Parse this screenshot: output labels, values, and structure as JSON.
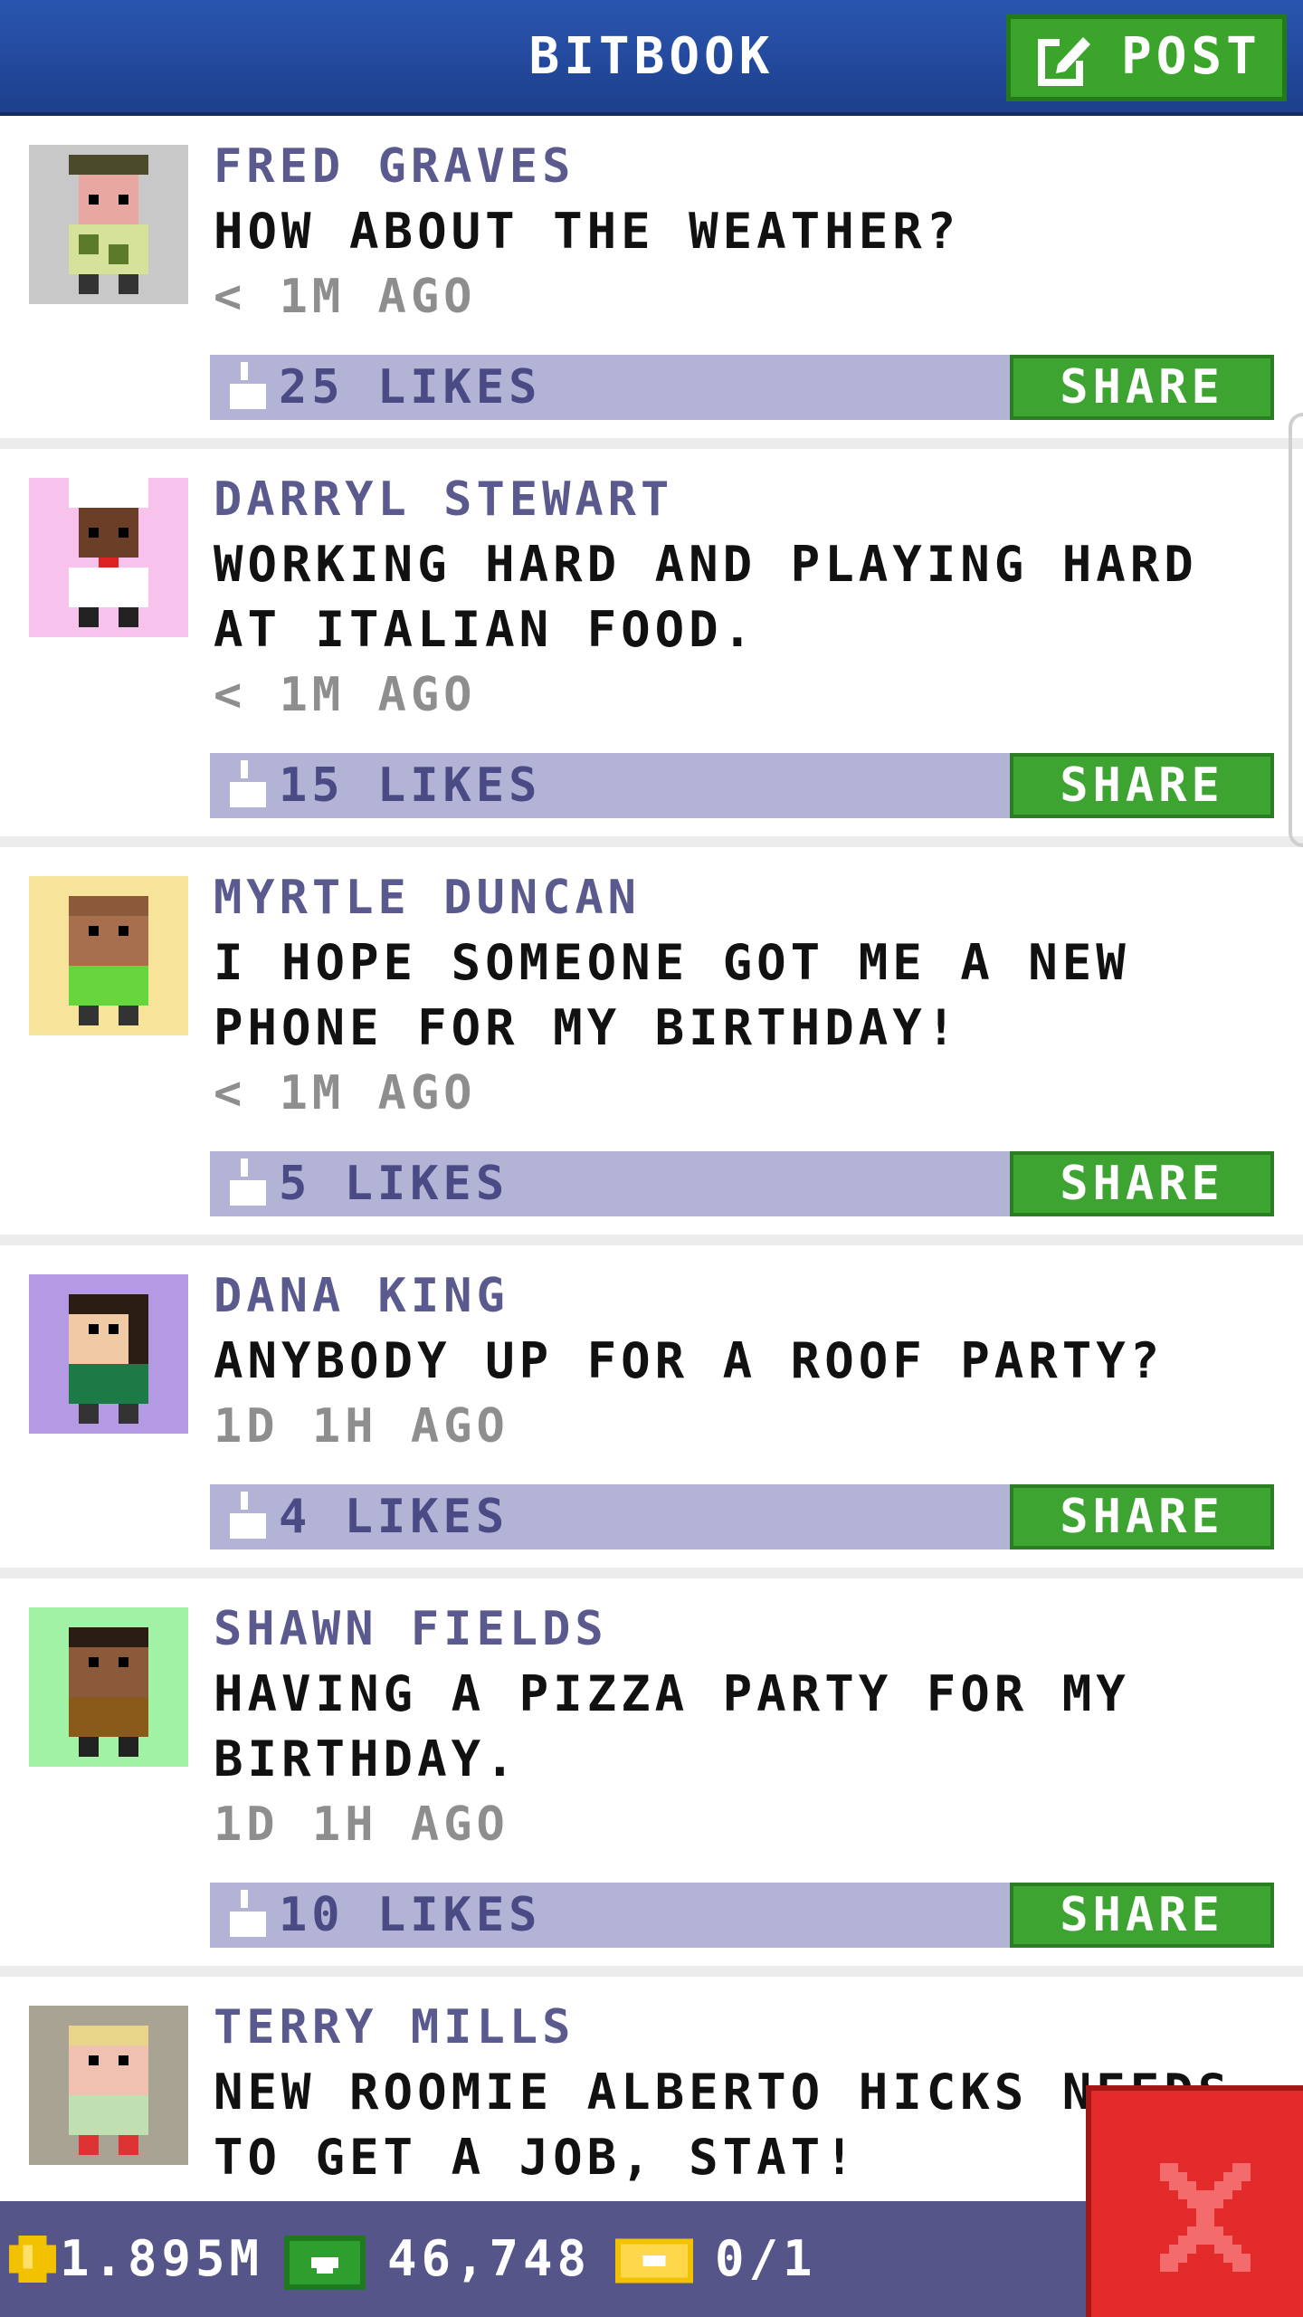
{
  "header": {
    "title": "BITBOOK",
    "post_label": "POST"
  },
  "posts": [
    {
      "author": "FRED GRAVES",
      "message": "HOW ABOUT THE WEATHER?",
      "time": "< 1M AGO",
      "likes": "25 LIKES",
      "share": "SHARE",
      "avatar_bg": "#c8c8c8",
      "avatar_icon": "man-with-flat-cap-avatar"
    },
    {
      "author": "DARRYL STEWART",
      "message": "WORKING HARD AND PLAYING HARD AT ITALIAN FOOD.",
      "time": "< 1M AGO",
      "likes": "15 LIKES",
      "share": "SHARE",
      "avatar_bg": "#f7c3ec",
      "avatar_icon": "chef-avatar"
    },
    {
      "author": "MYRTLE DUNCAN",
      "message": "I HOPE SOMEONE GOT ME A NEW PHONE FOR MY BIRTHDAY!",
      "time": "< 1M AGO",
      "likes": "5 LIKES",
      "share": "SHARE",
      "avatar_bg": "#f7e49a",
      "avatar_icon": "woman-green-shirt-avatar"
    },
    {
      "author": "DANA KING",
      "message": "ANYBODY UP FOR A ROOF PARTY?",
      "time": "1D 1H AGO",
      "likes": "4 LIKES",
      "share": "SHARE",
      "avatar_bg": "#b39ae2",
      "avatar_icon": "woman-dark-hair-avatar"
    },
    {
      "author": "SHAWN FIELDS",
      "message": "HAVING A PIZZA PARTY FOR MY BIRTHDAY.",
      "time": "1D 1H AGO",
      "likes": "10 LIKES",
      "share": "SHARE",
      "avatar_bg": "#a2f2a6",
      "avatar_icon": "man-brown-shirt-avatar"
    },
    {
      "author": "TERRY MILLS",
      "message": "NEW ROOMIE ALBERTO HICKS NEEDS TO GET A JOB, STAT!",
      "avatar_bg": "#a9a393",
      "avatar_icon": "blond-man-avatar"
    }
  ],
  "footer": {
    "coins": "1.895M",
    "cash": "46,748",
    "bux": "0/1"
  },
  "colors": {
    "header": "#1d3f8c",
    "accent_green": "#3ea431",
    "like_bar": "#b3b3d6",
    "close_red": "#e32b2b"
  }
}
